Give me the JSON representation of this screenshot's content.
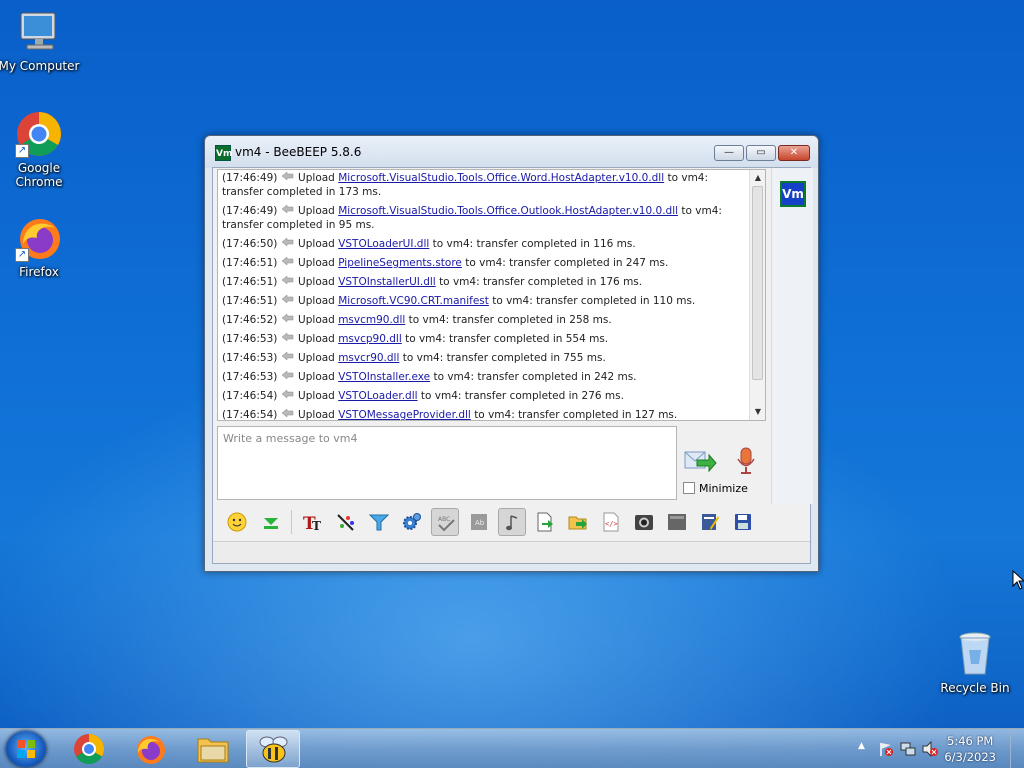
{
  "desktop": {
    "icons": [
      {
        "label": "My Computer"
      },
      {
        "label": "Google Chrome"
      },
      {
        "label": "Firefox"
      },
      {
        "label": "Recycle Bin"
      }
    ]
  },
  "window": {
    "title": "vm4 - BeeBEEP 5.8.6",
    "app_icon_text": "Vm",
    "controls": {
      "minimize": "—",
      "maximize": "▭",
      "close": "✕"
    },
    "log": [
      {
        "time": "(17:46:49)",
        "action": "Upload",
        "file": "Microsoft.VisualStudio.Tools.Office.Word.HostAdapter.v10.0.dll",
        "rest": "to vm4: transfer completed in 173 ms."
      },
      {
        "time": "(17:46:49)",
        "action": "Upload",
        "file": "Microsoft.VisualStudio.Tools.Office.Outlook.HostAdapter.v10.0.dll",
        "rest": "to vm4: transfer completed in 95 ms."
      },
      {
        "time": "(17:46:50)",
        "action": "Upload",
        "file": "VSTOLoaderUI.dll",
        "rest": "to vm4: transfer completed in 116 ms."
      },
      {
        "time": "(17:46:51)",
        "action": "Upload",
        "file": "PipelineSegments.store",
        "rest": "to vm4: transfer completed in 247 ms."
      },
      {
        "time": "(17:46:51)",
        "action": "Upload",
        "file": "VSTOInstallerUI.dll",
        "rest": "to vm4: transfer completed in 176 ms."
      },
      {
        "time": "(17:46:51)",
        "action": "Upload",
        "file": "Microsoft.VC90.CRT.manifest",
        "rest": "to vm4: transfer completed in 110 ms."
      },
      {
        "time": "(17:46:52)",
        "action": "Upload",
        "file": "msvcm90.dll",
        "rest": "to vm4: transfer completed in 258 ms."
      },
      {
        "time": "(17:46:53)",
        "action": "Upload",
        "file": "msvcp90.dll",
        "rest": "to vm4: transfer completed in 554 ms."
      },
      {
        "time": "(17:46:53)",
        "action": "Upload",
        "file": "msvcr90.dll",
        "rest": "to vm4: transfer completed in 755 ms."
      },
      {
        "time": "(17:46:53)",
        "action": "Upload",
        "file": "VSTOInstaller.exe",
        "rest": "to vm4: transfer completed in 242 ms."
      },
      {
        "time": "(17:46:54)",
        "action": "Upload",
        "file": "VSTOLoader.dll",
        "rest": "to vm4: transfer completed in 276 ms."
      },
      {
        "time": "(17:46:54)",
        "action": "Upload",
        "file": "VSTOMessageProvider.dll",
        "rest": "to vm4: transfer completed in 127 ms."
      }
    ],
    "message_placeholder": "Write a message to vm4",
    "minimize_label": "Minimize",
    "user_badge": "Vm",
    "toolbar_icons": [
      "emoticon-icon",
      "download-icon",
      "font-icon",
      "color-icon",
      "filter-icon",
      "settings-icon",
      "spellcheck-icon",
      "word-complete-icon",
      "music-note-icon",
      "send-file-icon",
      "send-folder-icon",
      "html-icon",
      "screenshot-icon",
      "clear-icon",
      "edit-icon",
      "save-icon"
    ]
  },
  "taskbar": {
    "apps": [
      "chrome",
      "firefox",
      "file-explorer",
      "beebeep"
    ],
    "time": "5:46 PM",
    "date": "6/3/2023"
  },
  "colors": {
    "link": "#1a1aa8",
    "desktop": "#0f6fd6"
  }
}
